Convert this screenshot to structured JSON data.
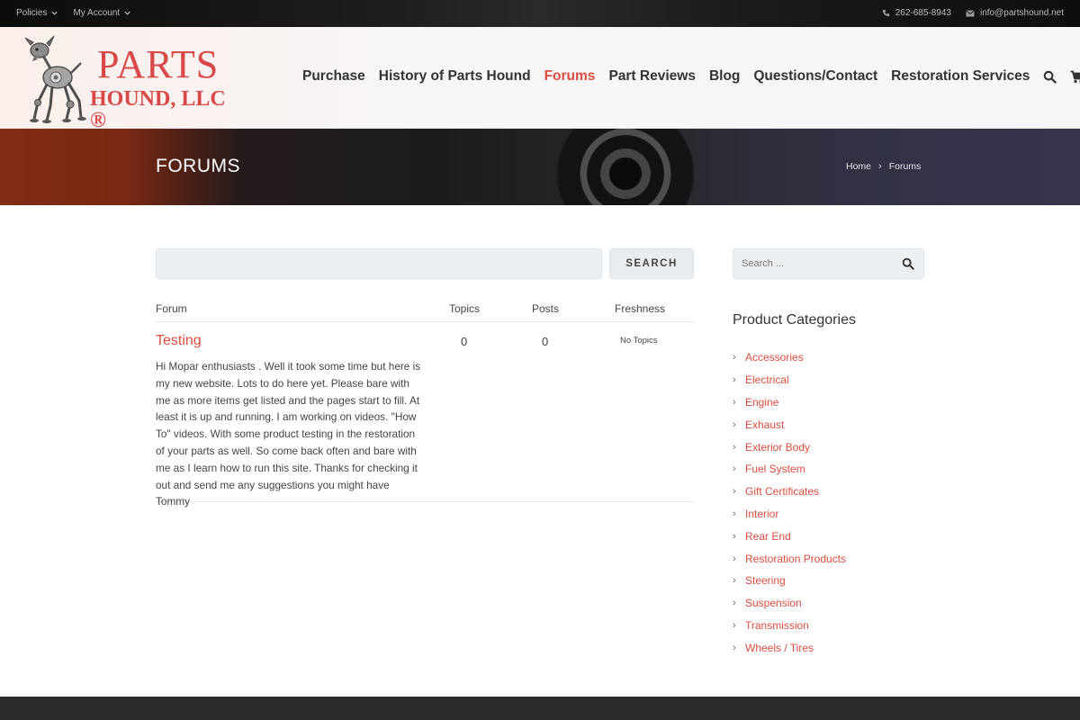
{
  "topbar": {
    "policies": "Policies",
    "account": "My Account",
    "phone": "262-685-8943",
    "email": "info@partshound.net"
  },
  "logo": {
    "line1": "PARTS",
    "line2": "HOUND, LLC ®"
  },
  "nav": {
    "items": [
      "Purchase",
      "History of Parts Hound",
      "Forums",
      "Part Reviews",
      "Blog",
      "Questions/Contact",
      "Restoration Services"
    ],
    "active": "Forums"
  },
  "banner": {
    "title": "FORUMS",
    "breadcrumb": [
      "Home",
      "Forums"
    ]
  },
  "forum_search": {
    "value": "",
    "button": "SEARCH"
  },
  "forum_table": {
    "headers": [
      "Forum",
      "Topics",
      "Posts",
      "Freshness"
    ],
    "rows": [
      {
        "name": "Testing",
        "topics": "0",
        "posts": "0",
        "freshness": "No Topics",
        "description": "Hi Mopar enthusiasts . Well it took some time but here is my new website. Lots to do here yet. Please bare with me as more items get listed and the pages start to fill. At least it is up and running. I am working on videos. \"How To\" videos.  With some product testing in the restoration of your parts as well. So come back often and bare with me as I learn how to run this site. Thanks for checking it out and send me any suggestions you might have Tommy"
      }
    ]
  },
  "sidebar": {
    "search_placeholder": "Search ...",
    "categories_title": "Product Categories",
    "categories": [
      "Accessories",
      "Electrical",
      "Engine",
      "Exhaust",
      "Exterior Body",
      "Fuel System",
      "Gift Certificates",
      "Interior",
      "Rear End",
      "Restoration Products",
      "Steering",
      "Suspension",
      "Transmission",
      "Wheels / Tires"
    ]
  },
  "colors": {
    "accent": "#dd4d3f",
    "text": "#333333",
    "topbar": "#151515",
    "footer": "#2a2a2a"
  }
}
